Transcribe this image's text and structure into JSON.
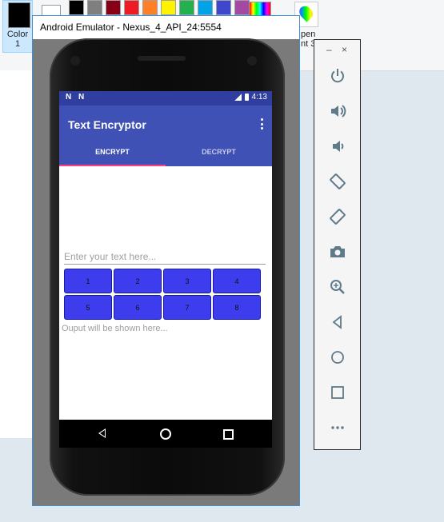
{
  "paint": {
    "color1_label": "Color\n1",
    "open_label": "pen\nnt 3",
    "palette": [
      "#000000",
      "#7f7f7f",
      "#880015",
      "#ed1c24",
      "#ff7f27",
      "#fff200",
      "#22b14c",
      "#00a2e8",
      "#3f48cc",
      "#a349a4"
    ]
  },
  "emulator": {
    "window_title": "Android Emulator - Nexus_4_API_24:5554",
    "status_left": [
      "N",
      "N"
    ],
    "time": "4:13",
    "app_title": "Text Encryptor",
    "tabs": [
      "ENCRYPT",
      "DECRYPT"
    ],
    "input_placeholder": "Enter your text here...",
    "keys": [
      "1",
      "2",
      "3",
      "4",
      "5",
      "6",
      "7",
      "8"
    ],
    "output_placeholder": "Ouput will be shown here..."
  },
  "toolbar": {
    "minimize": "–",
    "close": "×",
    "buttons": [
      "power-icon",
      "volume-up-icon",
      "volume-down-icon",
      "rotate-left-icon",
      "rotate-right-icon",
      "camera-icon",
      "zoom-icon",
      "back-icon",
      "home-icon",
      "overview-icon",
      "more-icon"
    ]
  },
  "colors": {
    "primary": "#3f51b5",
    "primary_dark": "#303f9f",
    "accent": "#ff4081",
    "key": "#3d3ded"
  }
}
